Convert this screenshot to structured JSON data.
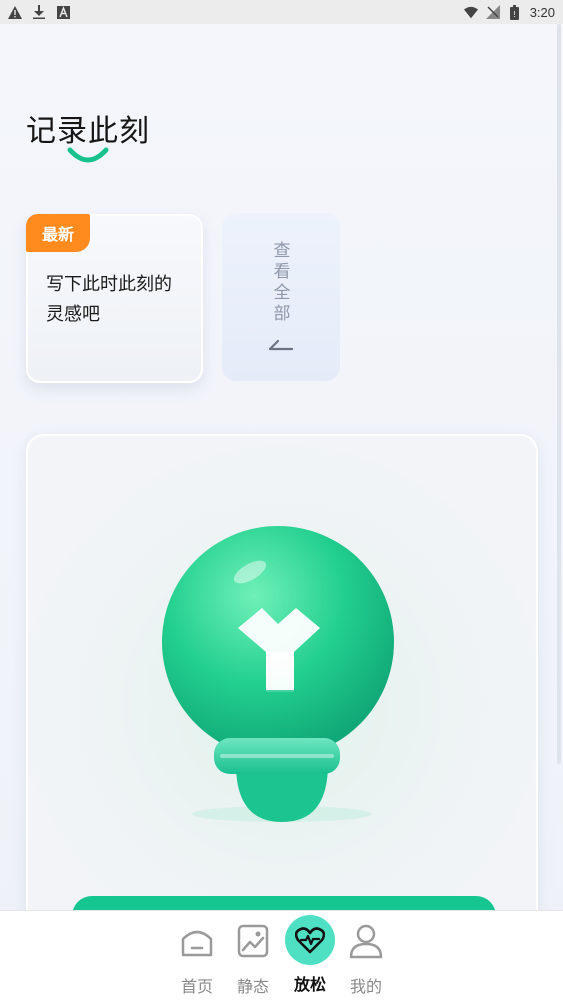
{
  "status_bar": {
    "time": "3:20",
    "left_icons": [
      "warning-icon",
      "download-icon",
      "a-box-icon"
    ],
    "right_icons": [
      "wifi-icon",
      "no-signal-icon",
      "battery-icon"
    ]
  },
  "page": {
    "title": "记录此刻"
  },
  "cards": {
    "latest": {
      "badge": "最新",
      "text": "写下此时此刻的灵感吧"
    },
    "view_all": {
      "label": "查看全部"
    }
  },
  "bottom_nav": {
    "items": [
      {
        "label": "首页",
        "icon": "home-icon"
      },
      {
        "label": "静态",
        "icon": "picture-icon"
      },
      {
        "label": "放松",
        "icon": "heart-pulse-icon"
      },
      {
        "label": "我的",
        "icon": "person-icon"
      }
    ],
    "active_index": 2
  },
  "colors": {
    "accent_green": "#16c690",
    "badge_orange": "#ff8a1e",
    "nav_active_bg": "#4fe0c3"
  }
}
